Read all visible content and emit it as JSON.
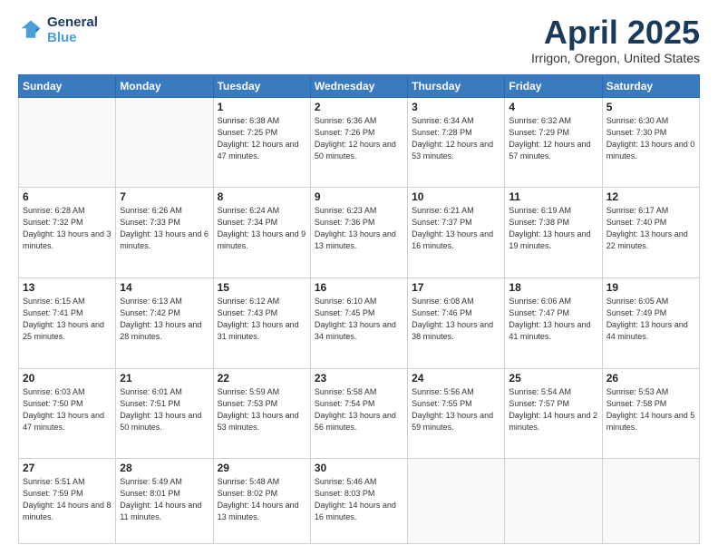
{
  "header": {
    "logo_line1": "General",
    "logo_line2": "Blue",
    "month_title": "April 2025",
    "location": "Irrigon, Oregon, United States"
  },
  "weekdays": [
    "Sunday",
    "Monday",
    "Tuesday",
    "Wednesday",
    "Thursday",
    "Friday",
    "Saturday"
  ],
  "weeks": [
    [
      {
        "day": "",
        "info": ""
      },
      {
        "day": "",
        "info": ""
      },
      {
        "day": "1",
        "info": "Sunrise: 6:38 AM\nSunset: 7:25 PM\nDaylight: 12 hours\nand 47 minutes."
      },
      {
        "day": "2",
        "info": "Sunrise: 6:36 AM\nSunset: 7:26 PM\nDaylight: 12 hours\nand 50 minutes."
      },
      {
        "day": "3",
        "info": "Sunrise: 6:34 AM\nSunset: 7:28 PM\nDaylight: 12 hours\nand 53 minutes."
      },
      {
        "day": "4",
        "info": "Sunrise: 6:32 AM\nSunset: 7:29 PM\nDaylight: 12 hours\nand 57 minutes."
      },
      {
        "day": "5",
        "info": "Sunrise: 6:30 AM\nSunset: 7:30 PM\nDaylight: 13 hours\nand 0 minutes."
      }
    ],
    [
      {
        "day": "6",
        "info": "Sunrise: 6:28 AM\nSunset: 7:32 PM\nDaylight: 13 hours\nand 3 minutes."
      },
      {
        "day": "7",
        "info": "Sunrise: 6:26 AM\nSunset: 7:33 PM\nDaylight: 13 hours\nand 6 minutes."
      },
      {
        "day": "8",
        "info": "Sunrise: 6:24 AM\nSunset: 7:34 PM\nDaylight: 13 hours\nand 9 minutes."
      },
      {
        "day": "9",
        "info": "Sunrise: 6:23 AM\nSunset: 7:36 PM\nDaylight: 13 hours\nand 13 minutes."
      },
      {
        "day": "10",
        "info": "Sunrise: 6:21 AM\nSunset: 7:37 PM\nDaylight: 13 hours\nand 16 minutes."
      },
      {
        "day": "11",
        "info": "Sunrise: 6:19 AM\nSunset: 7:38 PM\nDaylight: 13 hours\nand 19 minutes."
      },
      {
        "day": "12",
        "info": "Sunrise: 6:17 AM\nSunset: 7:40 PM\nDaylight: 13 hours\nand 22 minutes."
      }
    ],
    [
      {
        "day": "13",
        "info": "Sunrise: 6:15 AM\nSunset: 7:41 PM\nDaylight: 13 hours\nand 25 minutes."
      },
      {
        "day": "14",
        "info": "Sunrise: 6:13 AM\nSunset: 7:42 PM\nDaylight: 13 hours\nand 28 minutes."
      },
      {
        "day": "15",
        "info": "Sunrise: 6:12 AM\nSunset: 7:43 PM\nDaylight: 13 hours\nand 31 minutes."
      },
      {
        "day": "16",
        "info": "Sunrise: 6:10 AM\nSunset: 7:45 PM\nDaylight: 13 hours\nand 34 minutes."
      },
      {
        "day": "17",
        "info": "Sunrise: 6:08 AM\nSunset: 7:46 PM\nDaylight: 13 hours\nand 38 minutes."
      },
      {
        "day": "18",
        "info": "Sunrise: 6:06 AM\nSunset: 7:47 PM\nDaylight: 13 hours\nand 41 minutes."
      },
      {
        "day": "19",
        "info": "Sunrise: 6:05 AM\nSunset: 7:49 PM\nDaylight: 13 hours\nand 44 minutes."
      }
    ],
    [
      {
        "day": "20",
        "info": "Sunrise: 6:03 AM\nSunset: 7:50 PM\nDaylight: 13 hours\nand 47 minutes."
      },
      {
        "day": "21",
        "info": "Sunrise: 6:01 AM\nSunset: 7:51 PM\nDaylight: 13 hours\nand 50 minutes."
      },
      {
        "day": "22",
        "info": "Sunrise: 5:59 AM\nSunset: 7:53 PM\nDaylight: 13 hours\nand 53 minutes."
      },
      {
        "day": "23",
        "info": "Sunrise: 5:58 AM\nSunset: 7:54 PM\nDaylight: 13 hours\nand 56 minutes."
      },
      {
        "day": "24",
        "info": "Sunrise: 5:56 AM\nSunset: 7:55 PM\nDaylight: 13 hours\nand 59 minutes."
      },
      {
        "day": "25",
        "info": "Sunrise: 5:54 AM\nSunset: 7:57 PM\nDaylight: 14 hours\nand 2 minutes."
      },
      {
        "day": "26",
        "info": "Sunrise: 5:53 AM\nSunset: 7:58 PM\nDaylight: 14 hours\nand 5 minutes."
      }
    ],
    [
      {
        "day": "27",
        "info": "Sunrise: 5:51 AM\nSunset: 7:59 PM\nDaylight: 14 hours\nand 8 minutes."
      },
      {
        "day": "28",
        "info": "Sunrise: 5:49 AM\nSunset: 8:01 PM\nDaylight: 14 hours\nand 11 minutes."
      },
      {
        "day": "29",
        "info": "Sunrise: 5:48 AM\nSunset: 8:02 PM\nDaylight: 14 hours\nand 13 minutes."
      },
      {
        "day": "30",
        "info": "Sunrise: 5:46 AM\nSunset: 8:03 PM\nDaylight: 14 hours\nand 16 minutes."
      },
      {
        "day": "",
        "info": ""
      },
      {
        "day": "",
        "info": ""
      },
      {
        "day": "",
        "info": ""
      }
    ]
  ]
}
